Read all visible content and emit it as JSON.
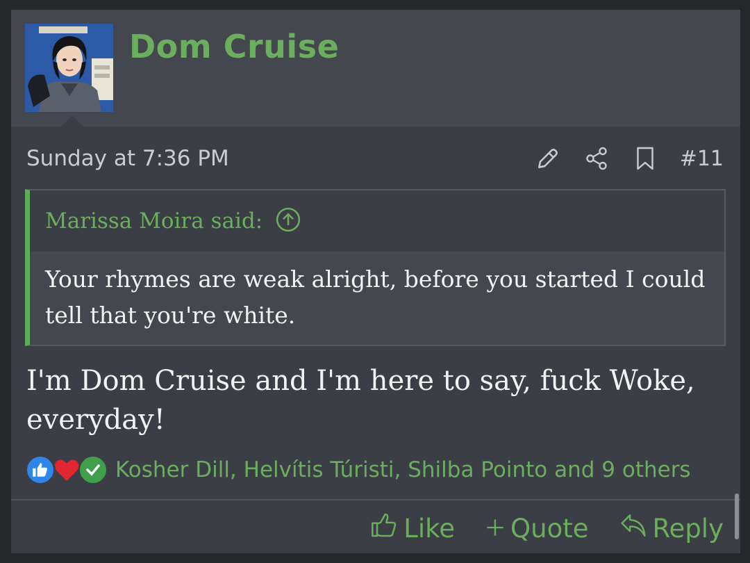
{
  "post": {
    "username": "Dom Cruise",
    "timestamp": "Sunday at 7:36 PM",
    "post_number": "#11",
    "icons": [
      "edit-icon",
      "share-icon",
      "bookmark-icon"
    ],
    "quote": {
      "author_label": "Marissa Moira said:",
      "text": "Your rhymes are weak alright, before you started I could tell that you're white."
    },
    "message": "I'm Dom Cruise and I'm here to say, fuck Woke, everyday!",
    "reactions": {
      "types": [
        "like",
        "love",
        "agree"
      ],
      "names": "Kosher Dill, Helvítis Túristi, Shilba Pointo and 9 others"
    },
    "actions": {
      "like": "Like",
      "quote": "Quote",
      "reply": "Reply"
    }
  },
  "colors": {
    "accent_green": "#6bae5e",
    "quote_bar": "#5cae58",
    "card_bg": "#3b3e44",
    "header_bg": "#44474d"
  }
}
